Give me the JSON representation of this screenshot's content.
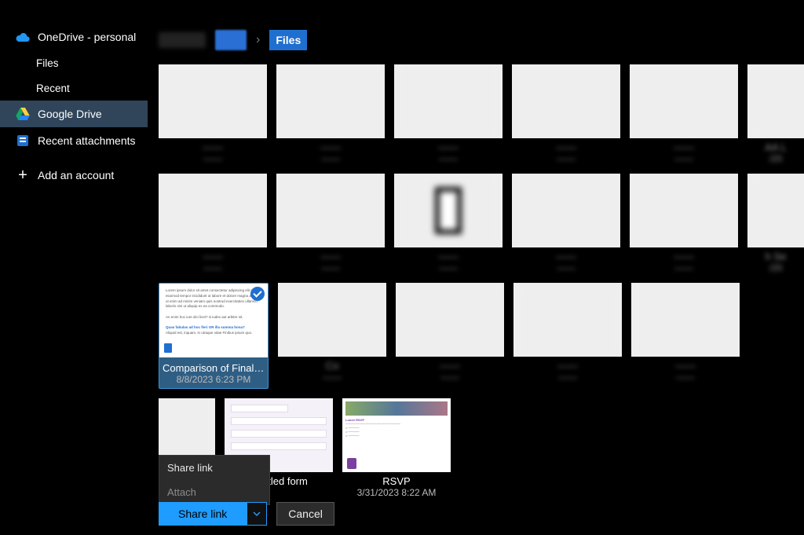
{
  "sidebar": {
    "accounts": [
      {
        "kind": "onedrive",
        "label": "OneDrive - personal",
        "children": [
          {
            "label": "Files"
          },
          {
            "label": "Recent"
          }
        ]
      },
      {
        "kind": "gdrive",
        "label": "Google Drive",
        "selected": true
      },
      {
        "kind": "recentattach",
        "label": "Recent attachments"
      }
    ],
    "add_account": "Add an account"
  },
  "breadcrumb": {
    "current": "Files"
  },
  "selected_tile": {
    "title": "Comparison of Final-Ho…",
    "date": "8/8/2023 6:23 PM"
  },
  "tiles_row3": [
    {
      "title": "Co",
      "blurred": true
    }
  ],
  "tiles_row4": [
    {
      "title": "Untitled form",
      "date": ""
    },
    {
      "title": "RSVP",
      "date": "3/31/2023 8:22 AM"
    }
  ],
  "context_menu": {
    "items": [
      {
        "label": "Share link",
        "dim": false
      },
      {
        "label": "Attach",
        "dim": true
      }
    ]
  },
  "actions": {
    "share": "Share link",
    "cancel": "Cancel"
  }
}
